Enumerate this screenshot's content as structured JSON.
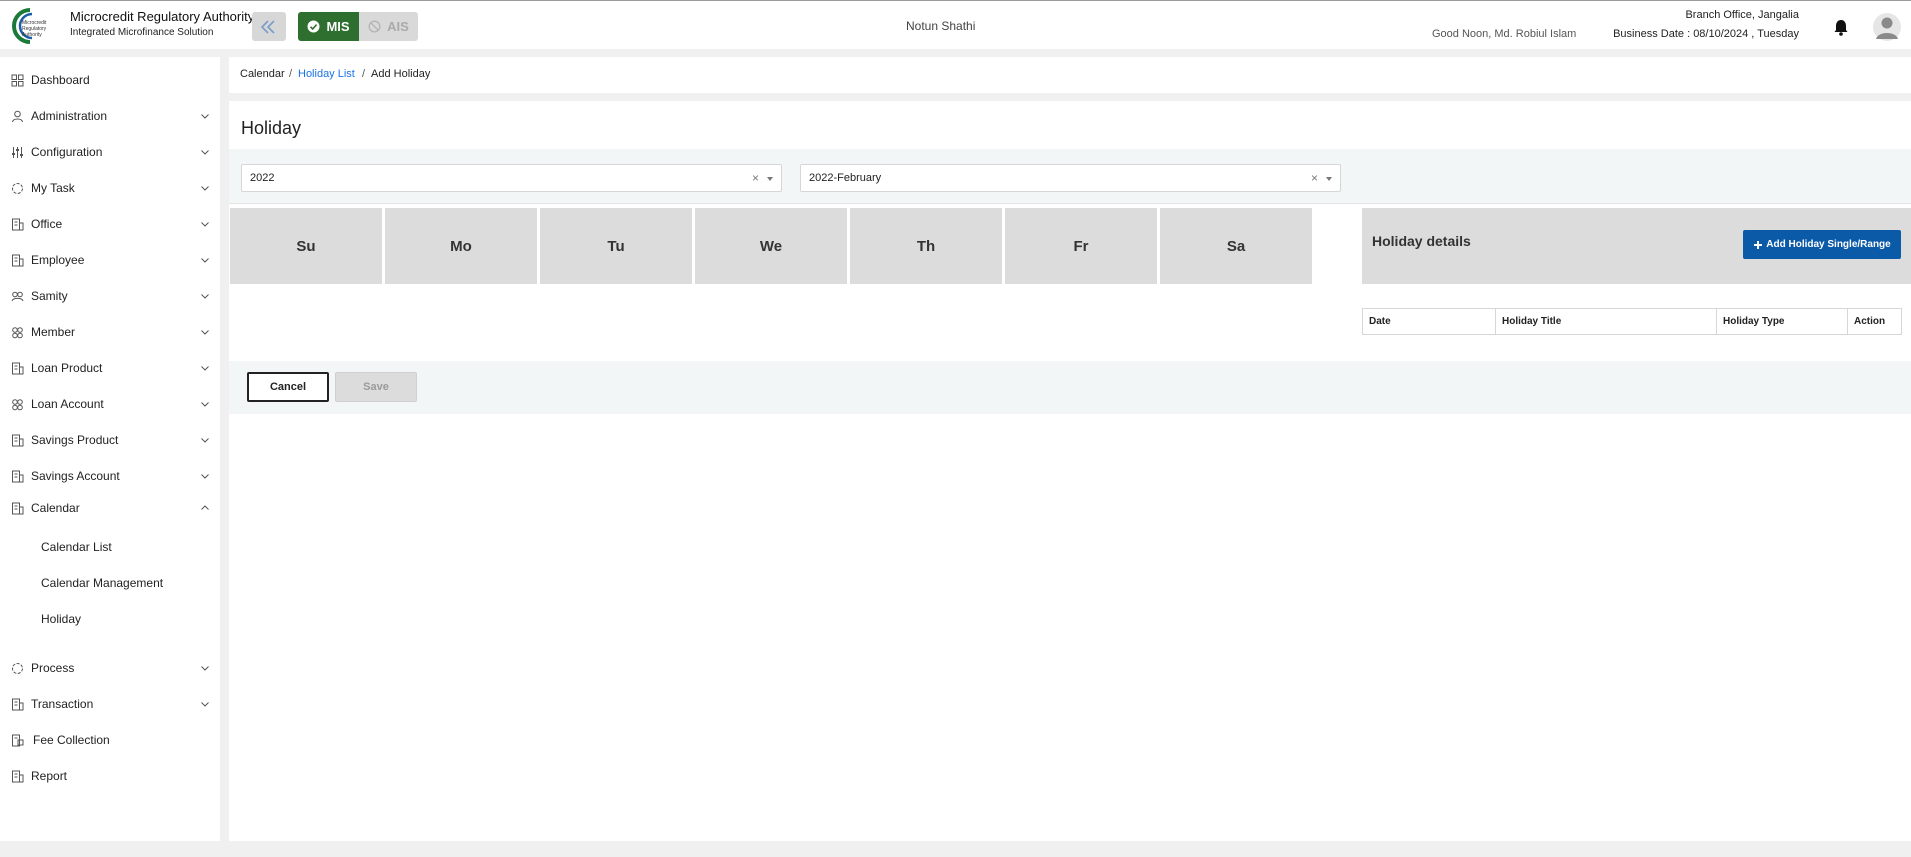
{
  "header": {
    "org_title": "Microcredit Regulatory Authority",
    "org_subtitle": "Integrated Microfinance Solution",
    "logo_text": "Microcredit Regulatory Authority",
    "mode_mis": "MIS",
    "mode_ais": "AIS",
    "center_title": "Notun Shathi",
    "greeting": "Good Noon, Md. Robiul Islam",
    "branch": "Branch Office, Jangalia",
    "business_date": "Business Date : 08/10/2024 , Tuesday"
  },
  "sidebar": {
    "items": [
      {
        "label": "Dashboard",
        "icon": "grid-icon"
      },
      {
        "label": "Administration",
        "icon": "admin-icon"
      },
      {
        "label": "Configuration",
        "icon": "sliders-icon"
      },
      {
        "label": "My Task",
        "icon": "task-icon"
      },
      {
        "label": "Office",
        "icon": "building-icon"
      },
      {
        "label": "Employee",
        "icon": "employee-icon"
      },
      {
        "label": "Samity",
        "icon": "group-icon"
      },
      {
        "label": "Member",
        "icon": "members-icon"
      },
      {
        "label": "Loan Product",
        "icon": "document-icon"
      },
      {
        "label": "Loan Account",
        "icon": "account-icon"
      },
      {
        "label": "Savings Product",
        "icon": "document-icon"
      },
      {
        "label": "Savings Account",
        "icon": "document-icon"
      },
      {
        "label": "Calendar",
        "icon": "document-icon"
      },
      {
        "label": "Process",
        "icon": "process-icon"
      },
      {
        "label": "Transaction",
        "icon": "document-icon"
      },
      {
        "label": "Fee Collection",
        "icon": "fee-icon"
      },
      {
        "label": "Report",
        "icon": "report-icon"
      }
    ],
    "calendar_sub": [
      "Calendar List",
      "Calendar Management",
      "Holiday"
    ]
  },
  "breadcrumb": {
    "root": "Calendar",
    "link": "Holiday List",
    "current": "Add Holiday",
    "separator": "/"
  },
  "page": {
    "title": "Holiday",
    "year_select": "2022",
    "month_select": "2022-February",
    "weekdays": [
      "Su",
      "Mo",
      "Tu",
      "We",
      "Th",
      "Fr",
      "Sa"
    ],
    "holiday_details_title": "Holiday details",
    "add_button": "Add Holiday Single/Range",
    "table_headers": [
      "Date",
      "Holiday Title",
      "Holiday Type",
      "Action"
    ],
    "cancel": "Cancel",
    "save": "Save"
  },
  "colors": {
    "mis_green": "#2e6e2e",
    "primary_blue": "#0b5aa8",
    "link_blue": "#1a73e8",
    "day_cell_gray": "#dcdcdc"
  }
}
